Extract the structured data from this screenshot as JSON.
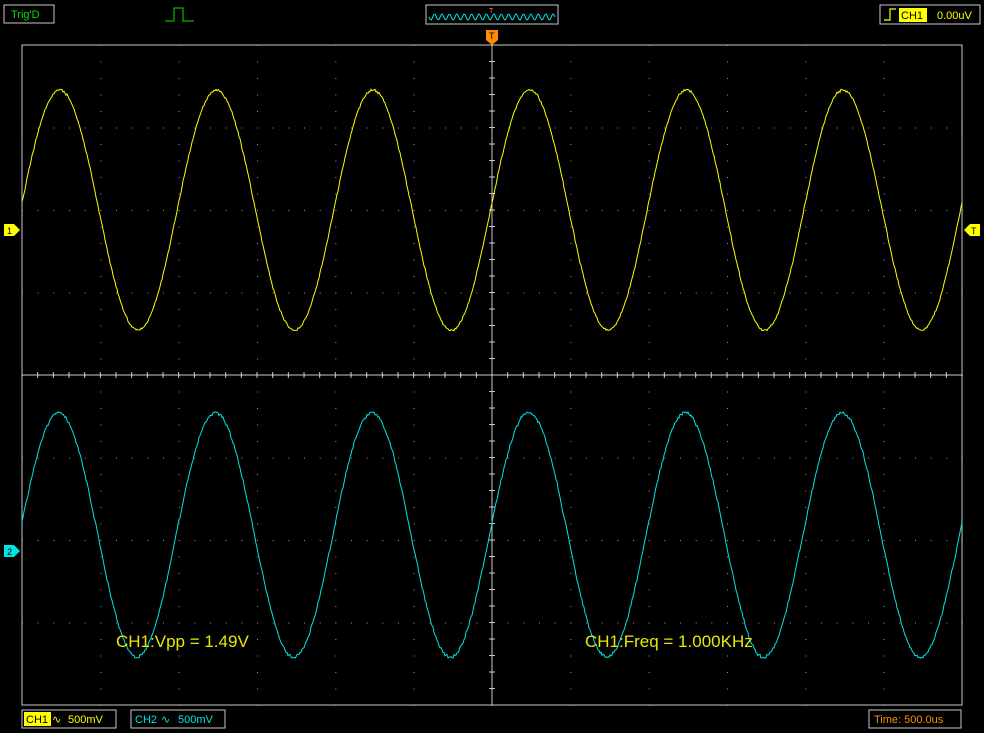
{
  "status": {
    "trig_state": "Trig'D",
    "trigger_source": "CH1",
    "trigger_level": "0.00uV",
    "trigger_marker": "T"
  },
  "markers": {
    "ch1": "1",
    "ch2": "2",
    "trigger_level_marker": "T"
  },
  "channels": [
    {
      "name": "CH1",
      "coupling_symbol": "∿",
      "scale": "500mV",
      "color": "#ffff00"
    },
    {
      "name": "CH2",
      "coupling_symbol": "∿",
      "scale": "500mV",
      "color": "#00e5e5"
    }
  ],
  "timebase": "Time: 500.0us",
  "measurements": {
    "vpp": "CH1:Vpp = 1.49V",
    "freq": "CH1:Freq = 1.000KHz"
  },
  "colors": {
    "background": "#000000",
    "grid": "#c8c8c8",
    "ch1": "#ffff00",
    "ch2": "#00e5e5",
    "trigger": "#ff8c00"
  },
  "chart_data": {
    "type": "line",
    "grid": true,
    "x_divisions": 12,
    "y_divisions": 8,
    "series": [
      {
        "name": "CH1",
        "waveform": "sine",
        "cycles_on_screen": 6,
        "peak_to_peak_V": 1.49,
        "frequency_Hz": 1000
      },
      {
        "name": "CH2",
        "waveform": "sine",
        "cycles_on_screen": 6
      }
    ]
  }
}
